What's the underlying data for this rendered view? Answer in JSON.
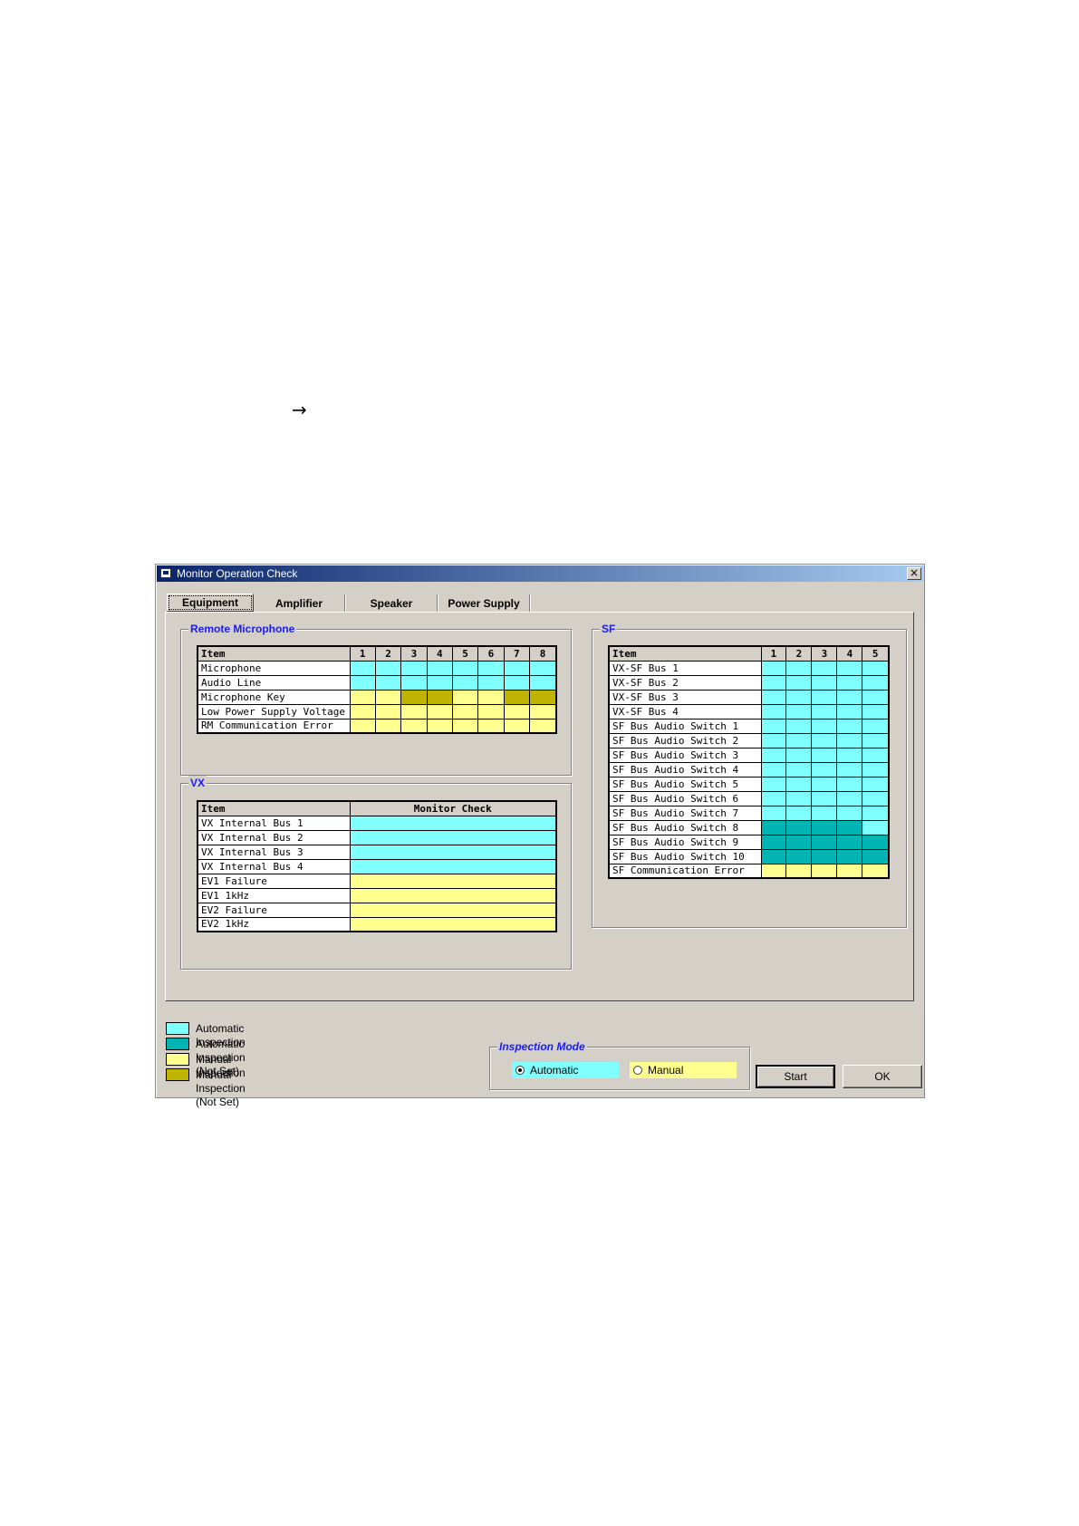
{
  "arrow": "→",
  "window": {
    "title": "Monitor Operation Check",
    "close_label": "×"
  },
  "tabs": [
    "Equipment",
    "Amplifier",
    "Speaker",
    "Power Supply"
  ],
  "colors": {
    "auto": "#80ffff",
    "auto_not_set": "#00b4b4",
    "manual": "#ffff90",
    "manual_not_set": "#c0b400"
  },
  "remote_mic": {
    "label": "Remote Microphone",
    "header_item": "Item",
    "columns": [
      "1",
      "2",
      "3",
      "4",
      "5",
      "6",
      "7",
      "8"
    ],
    "rows": [
      {
        "item": "Microphone",
        "cells": [
          "auto",
          "auto",
          "auto",
          "auto",
          "auto",
          "auto",
          "auto",
          "auto"
        ]
      },
      {
        "item": "Audio Line",
        "cells": [
          "auto",
          "auto",
          "auto",
          "auto",
          "auto",
          "auto",
          "auto",
          "auto"
        ]
      },
      {
        "item": "Microphone Key",
        "cells": [
          "man",
          "man",
          "manns",
          "manns",
          "man",
          "man",
          "manns",
          "manns"
        ]
      },
      {
        "item": "Low Power Supply Voltage",
        "cells": [
          "man",
          "man",
          "man",
          "man",
          "man",
          "man",
          "man",
          "man"
        ]
      },
      {
        "item": "RM Communication Error",
        "cells": [
          "man",
          "man",
          "man",
          "man",
          "man",
          "man",
          "man",
          "man"
        ]
      }
    ]
  },
  "vx": {
    "label": "VX",
    "header_item": "Item",
    "header_check": "Monitor Check",
    "rows": [
      {
        "item": "VX Internal Bus 1",
        "cell": "auto"
      },
      {
        "item": "VX Internal Bus 2",
        "cell": "auto"
      },
      {
        "item": "VX Internal Bus 3",
        "cell": "auto"
      },
      {
        "item": "VX Internal Bus 4",
        "cell": "auto"
      },
      {
        "item": "EV1 Failure",
        "cell": "man"
      },
      {
        "item": "EV1 1kHz",
        "cell": "man"
      },
      {
        "item": "EV2 Failure",
        "cell": "man"
      },
      {
        "item": "EV2 1kHz",
        "cell": "man"
      }
    ]
  },
  "sf": {
    "label": "SF",
    "header_item": "Item",
    "columns": [
      "1",
      "2",
      "3",
      "4",
      "5"
    ],
    "rows": [
      {
        "item": "VX-SF Bus 1",
        "cells": [
          "auto",
          "auto",
          "auto",
          "auto",
          "auto"
        ]
      },
      {
        "item": "VX-SF Bus 2",
        "cells": [
          "auto",
          "auto",
          "auto",
          "auto",
          "auto"
        ]
      },
      {
        "item": "VX-SF Bus 3",
        "cells": [
          "auto",
          "auto",
          "auto",
          "auto",
          "auto"
        ]
      },
      {
        "item": "VX-SF Bus 4",
        "cells": [
          "auto",
          "auto",
          "auto",
          "auto",
          "auto"
        ]
      },
      {
        "item": "SF Bus Audio Switch 1",
        "cells": [
          "auto",
          "auto",
          "auto",
          "auto",
          "auto"
        ]
      },
      {
        "item": "SF Bus Audio Switch 2",
        "cells": [
          "auto",
          "auto",
          "auto",
          "auto",
          "auto"
        ]
      },
      {
        "item": "SF Bus Audio Switch 3",
        "cells": [
          "auto",
          "auto",
          "auto",
          "auto",
          "auto"
        ]
      },
      {
        "item": "SF Bus Audio Switch 4",
        "cells": [
          "auto",
          "auto",
          "auto",
          "auto",
          "auto"
        ]
      },
      {
        "item": "SF Bus Audio Switch 5",
        "cells": [
          "auto",
          "auto",
          "auto",
          "auto",
          "auto"
        ]
      },
      {
        "item": "SF Bus Audio Switch 6",
        "cells": [
          "auto",
          "auto",
          "auto",
          "auto",
          "auto"
        ]
      },
      {
        "item": "SF Bus Audio Switch 7",
        "cells": [
          "auto",
          "auto",
          "auto",
          "auto",
          "auto"
        ]
      },
      {
        "item": "SF Bus Audio Switch 8",
        "cells": [
          "autons",
          "autons",
          "autons",
          "autons",
          "auto"
        ]
      },
      {
        "item": "SF Bus Audio Switch 9",
        "cells": [
          "autons",
          "autons",
          "autons",
          "autons",
          "autons"
        ]
      },
      {
        "item": "SF Bus Audio Switch 10",
        "cells": [
          "autons",
          "autons",
          "autons",
          "autons",
          "autons"
        ]
      },
      {
        "item": "SF Communication Error",
        "cells": [
          "man",
          "man",
          "man",
          "man",
          "man"
        ]
      }
    ]
  },
  "legend": [
    {
      "label": "Automatic Inspection",
      "cls": "auto"
    },
    {
      "label": "Automatic Inspection (Not Set)",
      "cls": "autons"
    },
    {
      "label": "Manual Inspection",
      "cls": "man"
    },
    {
      "label": "Manual Inspection (Not Set)",
      "cls": "manns"
    }
  ],
  "inspection_mode": {
    "label": "Inspection Mode",
    "automatic": "Automatic",
    "manual": "Manual",
    "selected": "Automatic"
  },
  "buttons": {
    "start": "Start",
    "ok": "OK"
  }
}
